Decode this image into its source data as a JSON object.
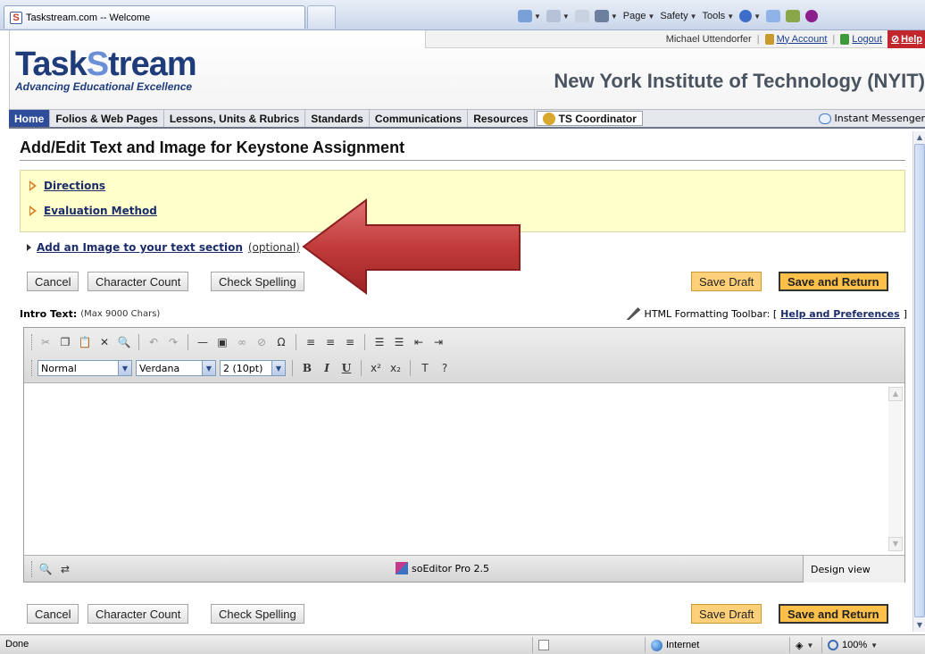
{
  "browser": {
    "tab_title": "Taskstream.com -- Welcome",
    "tab_favicon": "S",
    "commands": {
      "page": "Page",
      "safety": "Safety",
      "tools": "Tools"
    }
  },
  "account": {
    "user": "Michael Uttendorfer",
    "my_account": "My Account",
    "logout": "Logout",
    "help": "Help"
  },
  "brand": {
    "logo_part1": "Task",
    "logo_s": "S",
    "logo_part2": "tream",
    "tagline": "Advancing Educational Excellence",
    "institution": "New York Institute of Technology (NYIT)"
  },
  "nav": {
    "items": [
      {
        "label": "Home"
      },
      {
        "label": "Folios & Web Pages"
      },
      {
        "label": "Lessons, Units & Rubrics"
      },
      {
        "label": "Standards"
      },
      {
        "label": "Communications"
      },
      {
        "label": "Resources"
      }
    ],
    "coordinator": "TS Coordinator",
    "instant_messenger": "Instant Messenger"
  },
  "page": {
    "title": "Add/Edit Text and Image for Keystone Assignment",
    "directions": "Directions",
    "evaluation": "Evaluation Method",
    "add_image": "Add an Image to your text section",
    "add_image_optional": "(optional)"
  },
  "buttons": {
    "cancel": "Cancel",
    "character_count": "Character Count",
    "check_spelling": "Check Spelling",
    "save_draft": "Save Draft",
    "save_return": "Save and Return"
  },
  "intro": {
    "label": "Intro Text:",
    "limit": "(Max 9000 Chars)",
    "toolbar_label": "HTML Formatting Toolbar: [",
    "help_link": "Help and Preferences",
    "close_bracket": "]"
  },
  "editor": {
    "format_select": "Normal",
    "font_select": "Verdana",
    "size_select": "2 (10pt)",
    "brand": "soEditor Pro 2.5",
    "view_mode": "Design view",
    "text": ""
  },
  "status": {
    "text": "Done",
    "zone": "Internet",
    "zoom": "100%"
  },
  "colors": {
    "accent_red": "#c1272d",
    "nav_active": "#2f4d9a",
    "save_button": "#ffc04a",
    "info_bg": "#ffffcc"
  }
}
